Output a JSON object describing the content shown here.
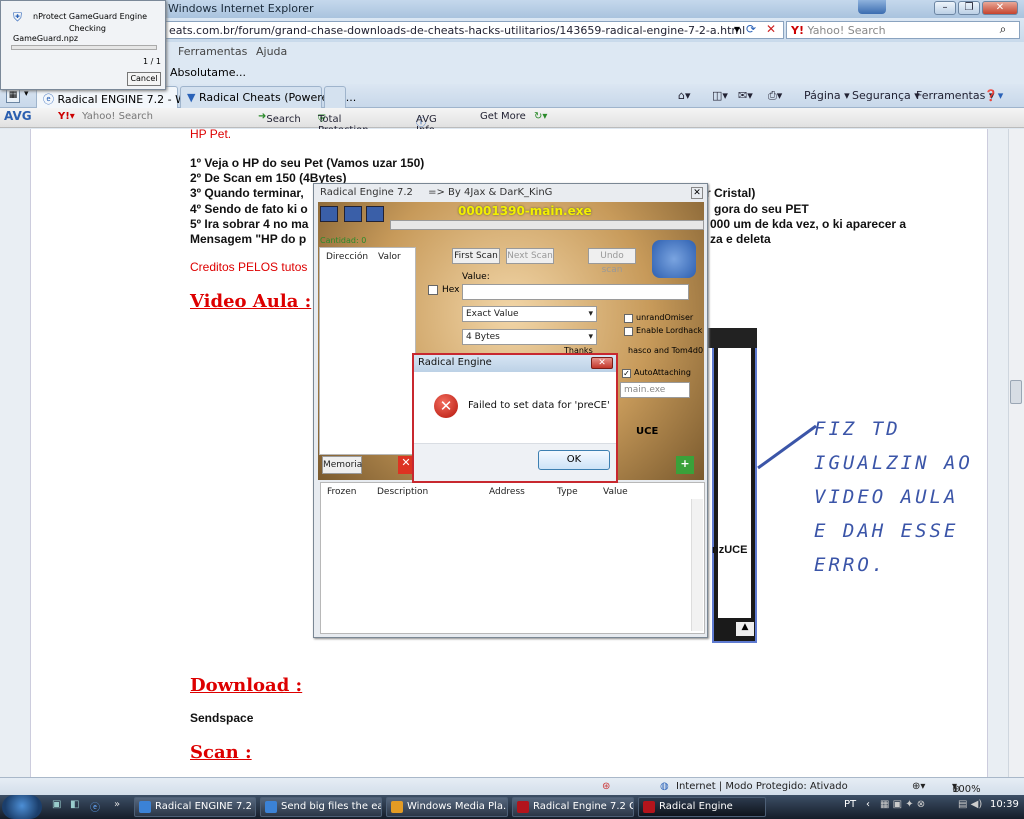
{
  "ie": {
    "title": "Windows Internet Explorer",
    "address": "eats.com.br/forum/grand-chase-downloads-de-cheats-hacks-utilitarios/143659-radical-engine-7-2-a.html",
    "search_placeholder": "Yahoo! Search",
    "menu": [
      "Ferramentas",
      "Ajuda"
    ],
    "favorites_text": "Absolutame...",
    "tabs": [
      {
        "label": "Radical ENGINE 7.2 - W..."
      },
      {
        "label": "Radical Cheats (Powered b..."
      }
    ],
    "commands": [
      "Página ▾",
      "Segurança ▾",
      "Ferramentas ▾"
    ]
  },
  "avg_toolbar": {
    "logo": "AVG",
    "yahoo_search": "Yahoo! Search",
    "search_btn": "Search",
    "total_protection": "Total Protection",
    "avg_info": "AVG Info ▾",
    "get_more": "Get More"
  },
  "nprotect": {
    "title": "nProtect GameGuard Engine",
    "status": "Checking",
    "file": "GameGuard.npz",
    "progress_fraction": 1.0,
    "count": "1 / 1",
    "cancel": "Cancel"
  },
  "content": {
    "hp_pet": "HP Pet.",
    "steps": [
      "1º Veja o HP do seu Pet (Vamos uzar 150)",
      "2º De Scan em 150 (4Bytes)",
      "3º Quando terminar,",
      "4º Sendo de fato ki o",
      "5º Ira sobrar 4 no ma",
      "Mensagem \"HP do p"
    ],
    "steps_right": [
      "r Cristal)",
      "gora do seu PET",
      "000 um de kda vez, o ki aparecer a",
      "za e deleta"
    ],
    "credits": "Creditos PELOS tutos",
    "video_aula": "Video Aula :",
    "download": "Download :",
    "sendspace": "Sendspace",
    "scan": "Scan :",
    "partial_uce": "nzUCE"
  },
  "radical_engine": {
    "title": "Radical Engine 7.2",
    "subtitle": "=> By 4Jax & DarK_KinG",
    "process": "00001390-main.exe",
    "found_label": "Cantidad: 0",
    "list_headers": [
      "Dirección",
      "Valor"
    ],
    "first_scan": "First Scan",
    "next_scan": "Next Scan",
    "undo_scan": "Undo scan",
    "value_label": "Value:",
    "hex_label": "Hex",
    "scan_type": "Exact Value",
    "value_type": "4 Bytes",
    "unrandomiser": "unrandOmiser",
    "enable_lordhack": "Enable Lordhack",
    "thanks": "Thanks",
    "thanks_rest": "hasco and Tom4d0",
    "auto_attaching": "AutoAttaching",
    "attach_process": "main.exe",
    "uce": "UCE",
    "memoria": "Memoria",
    "table_headers": [
      "Frozen",
      "Description",
      "Address",
      "Type",
      "Value"
    ]
  },
  "error_dialog": {
    "title": "Radical Engine",
    "message": "Failed to set data for 'preCE'",
    "ok": "OK"
  },
  "handwriting": "FIZ TD\nIGUALZIN AO\nVIDEO AULA\nE DAH ESSE\nERRO.",
  "status_bar": {
    "zone": "Internet | Modo Protegido: Ativado",
    "zoom": "100%"
  },
  "taskbar": {
    "items": [
      "Radical ENGINE 7.2 ...",
      "Send big files the ea...",
      "Windows Media Pla...",
      "Radical Engine 7.2 G...",
      "Radical Engine"
    ],
    "lang": "PT",
    "time": "10:39"
  }
}
